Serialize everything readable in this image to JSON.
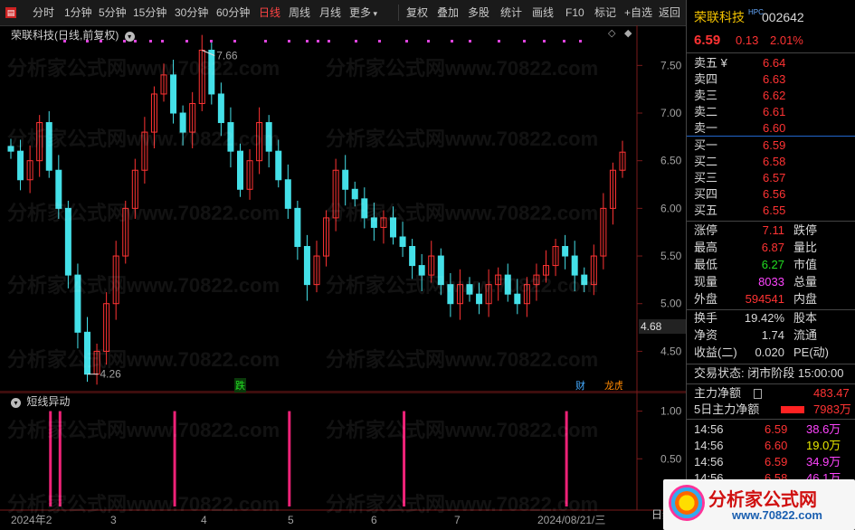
{
  "toolbar": {
    "left_items": [
      "分时",
      "1分钟",
      "5分钟",
      "15分钟",
      "30分钟",
      "60分钟",
      "日线",
      "周线",
      "月线",
      "更多"
    ],
    "active_item": "日线",
    "right_items": [
      "复权",
      "叠加",
      "多股",
      "统计",
      "画线",
      "F10",
      "标记",
      "+自选",
      "返回"
    ]
  },
  "chart": {
    "title": "荣联科技(日线,前复权)",
    "high_label": "7.66",
    "low_label": "4.26",
    "current_price_label": "4.68",
    "price_ticks": [
      "7.50",
      "7.00",
      "6.50",
      "6.00",
      "5.50",
      "5.00",
      "4.50"
    ],
    "event_tags": [
      "跌",
      "财",
      "龙虎榜"
    ],
    "x_labels": [
      "2024年2",
      "3",
      "4",
      "5",
      "6",
      "7",
      "2024/08/21/三"
    ],
    "colors": {
      "up": "#ff3333",
      "down": "#44e0e8",
      "bg": "#000000",
      "grid": "#7a1a1a",
      "dots": "#dd44dd"
    }
  },
  "indicator": {
    "title": "短线异动",
    "ticks": [
      "1.00",
      "0.50"
    ],
    "bar_color": "#ee2277",
    "right_label": "日线"
  },
  "chart_data": {
    "type": "candlestick",
    "x": [
      "2024-02",
      "2024-03",
      "2024-04",
      "2024-05",
      "2024-06",
      "2024-07",
      "2024-08-21"
    ],
    "ylim": [
      4.2,
      7.75
    ],
    "close_series_approx": [
      6.6,
      6.3,
      6.5,
      6.9,
      6.4,
      6.0,
      5.3,
      4.7,
      4.26,
      4.5,
      5.0,
      5.5,
      6.0,
      6.4,
      6.8,
      7.2,
      7.4,
      7.0,
      6.8,
      7.1,
      7.66,
      7.2,
      6.9,
      6.6,
      6.2,
      6.5,
      6.9,
      6.6,
      6.3,
      6.0,
      5.6,
      5.2,
      5.5,
      5.9,
      6.4,
      6.2,
      6.1,
      5.9,
      5.8,
      5.9,
      5.7,
      5.6,
      5.4,
      5.3,
      5.5,
      5.2,
      5.0,
      5.2,
      5.1,
      5.0,
      5.2,
      5.3,
      5.1,
      5.0,
      5.2,
      5.3,
      5.4,
      5.6,
      5.5,
      5.3,
      5.2,
      5.5,
      6.0,
      6.4,
      6.59
    ],
    "indicator_signals": [
      1,
      1,
      1,
      1,
      1
    ],
    "indicator_ylim": [
      0,
      1.1
    ]
  },
  "quote": {
    "name": "荣联科技",
    "tag": "HPC",
    "code": "002642",
    "price": "6.59",
    "change": "0.13",
    "change_pct": "2.01%",
    "asks": [
      {
        "label": "卖五 ¥",
        "price": "6.64"
      },
      {
        "label": "卖四",
        "price": "6.63"
      },
      {
        "label": "卖三",
        "price": "6.62"
      },
      {
        "label": "卖二",
        "price": "6.61"
      },
      {
        "label": "卖一",
        "price": "6.60"
      }
    ],
    "bids": [
      {
        "label": "买一",
        "price": "6.59"
      },
      {
        "label": "买二",
        "price": "6.58"
      },
      {
        "label": "买三",
        "price": "6.57"
      },
      {
        "label": "买四",
        "price": "6.56"
      },
      {
        "label": "买五",
        "price": "6.55"
      }
    ],
    "stats": [
      {
        "label": "涨停",
        "value": "7.11",
        "right": "跌停"
      },
      {
        "label": "最高",
        "value": "6.87",
        "right": "量比"
      },
      {
        "label": "最低",
        "value": "6.27",
        "right": "市值"
      },
      {
        "label": "现量",
        "value": "8033",
        "right": "总量"
      },
      {
        "label": "外盘",
        "value": "594541",
        "right": "内盘"
      }
    ],
    "fin": [
      {
        "label": "换手",
        "value": "19.42%",
        "right": "股本"
      },
      {
        "label": "净资",
        "value": "1.74",
        "right": "流通"
      },
      {
        "label": "收益(二)",
        "value": "0.020",
        "right": "PE(动)"
      }
    ],
    "status": "交易状态: 闭市阶段 15:00:00",
    "main_net": {
      "label": "主力净额",
      "value": "483.47"
    },
    "main_net5": {
      "label": "5日主力净额",
      "value": "7983万"
    },
    "ticks": [
      {
        "time": "14:56",
        "price": "6.59",
        "vol": "38.6万"
      },
      {
        "time": "14:56",
        "price": "6.60",
        "vol": "19.0万"
      },
      {
        "time": "14:56",
        "price": "6.59",
        "vol": "34.9万"
      },
      {
        "time": "14:56",
        "price": "6.58",
        "vol": "46.1万"
      }
    ]
  },
  "watermark": {
    "text": "分析家公式网www.70822.com",
    "logo_text": "分析家公式网",
    "logo_url": "www.70822.com"
  }
}
